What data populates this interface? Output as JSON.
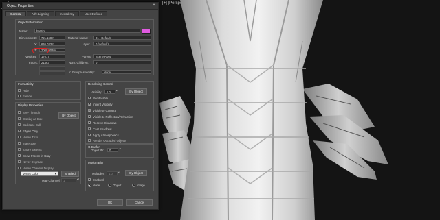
{
  "viewport": {
    "label": "[+] [Perspective] [Realistic]"
  },
  "dialog": {
    "title": "Object Properties",
    "close": "×",
    "tabs": [
      "General",
      "Adv. Lighting",
      "mental ray",
      "User Defined"
    ],
    "object_info": {
      "title": "Object Information",
      "name_label": "Name:",
      "name_value": "batBig",
      "dimensions_label": "Dimensions:",
      "x_label": "X:",
      "x_value": "721,168m",
      "y_label": "Y:",
      "y_value": "646,033m",
      "z_label": "Z:",
      "z_value": "2000,003m",
      "material_name_label": "Material Name:",
      "material_name_value": "01 - Default",
      "layer_label": "Layer:",
      "layer_value": "0 (default)",
      "vertices_label": "Vertices:",
      "vertices_value": "17017",
      "faces_label": "Faces:",
      "faces_value": "21463",
      "parent_label": "Parent:",
      "parent_value": "Scene Root",
      "num_children_label": "Num. Children:",
      "num_children_value": "0",
      "in_group_label": "In Group/Assembly:",
      "in_group_value": "None"
    },
    "interactivity": {
      "title": "Interactivity",
      "items": [
        {
          "label": "Hide",
          "checked": false
        },
        {
          "label": "Freeze",
          "checked": false
        }
      ]
    },
    "display_properties": {
      "title": "Display Properties",
      "by_object_label": "By Object",
      "items": [
        {
          "label": "See-Through",
          "checked": false
        },
        {
          "label": "Display as Box",
          "checked": false
        },
        {
          "label": "Backface Cull",
          "checked": false
        },
        {
          "label": "Edges Only",
          "checked": true
        },
        {
          "label": "Vertex Ticks",
          "checked": false
        },
        {
          "label": "Trajectory",
          "checked": false
        },
        {
          "label": "Ignore Extents",
          "checked": false
        },
        {
          "label": "Show Frozen in Gray",
          "checked": true
        },
        {
          "label": "Never Degrade",
          "checked": false
        },
        {
          "label": "Vertex Channel Display",
          "checked": false
        }
      ],
      "vertex_color_value": "Vertex Color",
      "shaded_label": "Shaded",
      "map_channel_label": "Map Channel:",
      "map_channel_value": "1"
    },
    "rendering_control": {
      "title": "Rendering Control",
      "visibility_label": "Visibility:",
      "visibility_value": "1,0",
      "by_object_label": "By Object",
      "items": [
        {
          "label": "Renderable",
          "checked": true
        },
        {
          "label": "Inherit Visibility",
          "checked": true
        },
        {
          "label": "Visible to Camera",
          "checked": true
        },
        {
          "label": "Visible to Reflection/Refraction",
          "checked": true
        },
        {
          "label": "Receive Shadows",
          "checked": true
        },
        {
          "label": "Cast Shadows",
          "checked": true
        },
        {
          "label": "Apply Atmospherics",
          "checked": true
        },
        {
          "label": "Render Occluded Objects",
          "checked": false
        }
      ]
    },
    "gbuffer": {
      "title": "G-Buffer",
      "object_id_label": "Object ID:",
      "object_id_value": "0"
    },
    "motion_blur": {
      "title": "Motion Blur",
      "multiplier_label": "Multiplier:",
      "multiplier_value": "1,0",
      "by_object_label": "By Object",
      "enabled_label": "Enabled",
      "enabled_checked": true,
      "radios": [
        {
          "label": "None",
          "selected": true
        },
        {
          "label": "Object",
          "selected": false
        },
        {
          "label": "Image",
          "selected": false
        }
      ]
    },
    "buttons": {
      "ok": "OK",
      "cancel": "Cancel"
    }
  },
  "colors": {
    "swatch": "#e05ae0",
    "highlight": "#e02020"
  }
}
